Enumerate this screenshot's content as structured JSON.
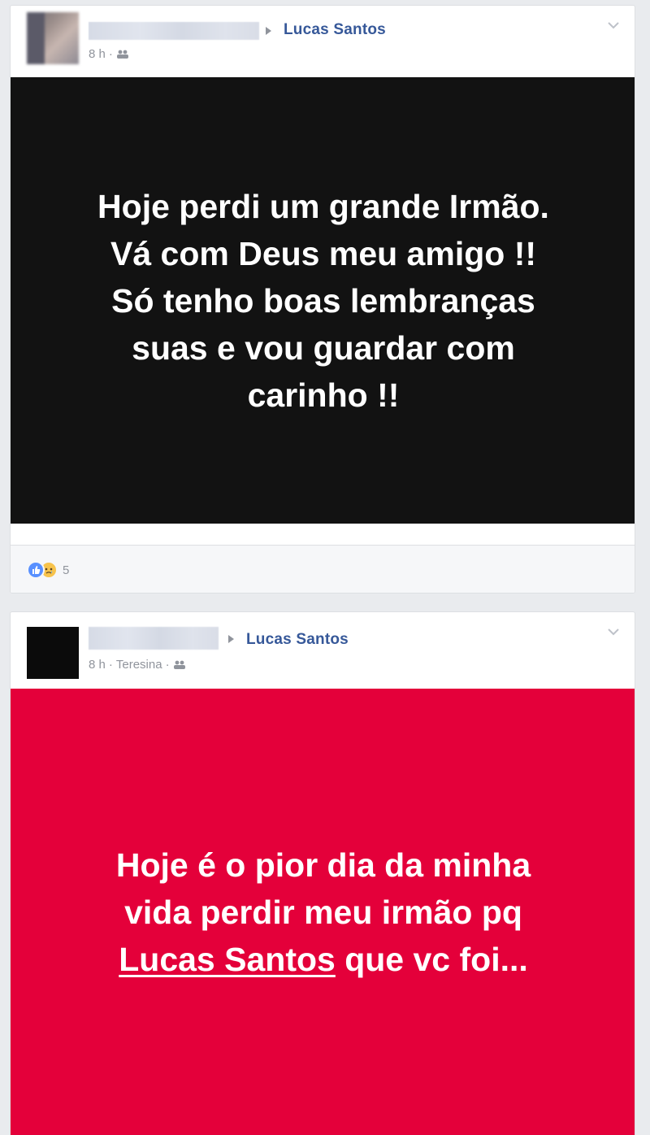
{
  "posts": [
    {
      "target_name": "Lucas Santos",
      "time": "8 h",
      "location": "",
      "audience_icon": "friends-icon",
      "banner_text": "Hoje perdi um grande Irmão.\nVá com Deus meu amigo !!\nSó tenho boas lembranças\nsuas e vou guardar com\ncarinho !!",
      "banner_color": "#121212",
      "reactions": [
        "like-icon",
        "sad-icon"
      ],
      "reaction_count": "5"
    },
    {
      "target_name": "Lucas Santos",
      "time": "8 h",
      "location": "Teresina",
      "audience_icon": "friends-icon",
      "banner_text_before": "Hoje é o pior dia da minha\nvida perdir meu irmão pq\n",
      "banner_mention": "Lucas Santos",
      "banner_text_after": " que vc foi...",
      "banner_color": "#e4003a"
    }
  ]
}
